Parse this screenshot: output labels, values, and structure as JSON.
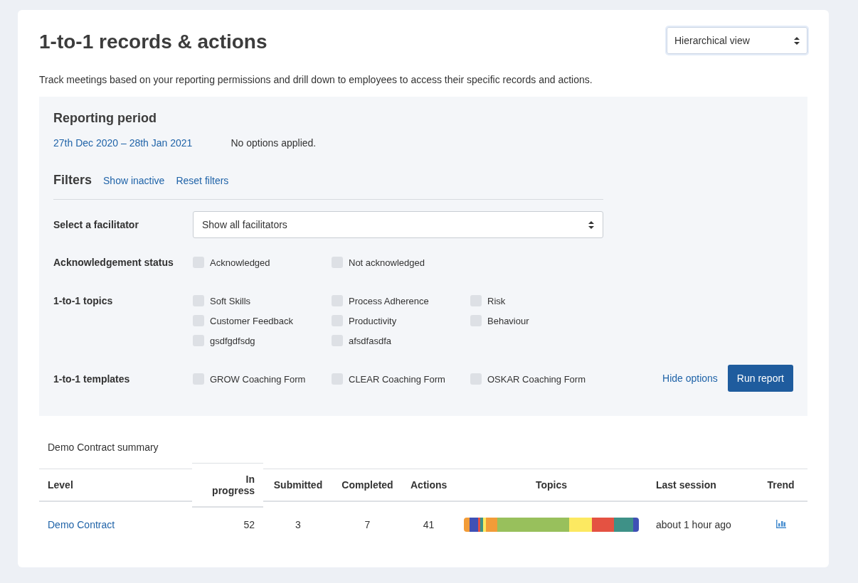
{
  "title": "1-to-1 records & actions",
  "view_select": {
    "value": "Hierarchical view"
  },
  "description": "Track meetings based on your reporting permissions and drill down to employees to access their specific records and actions.",
  "reporting_period": {
    "heading": "Reporting period",
    "date_range": "27th Dec 2020 – 28th Jan 2021",
    "note": "No options applied."
  },
  "filters": {
    "heading": "Filters",
    "links": [
      "Show inactive",
      "Reset filters"
    ],
    "facilitator": {
      "label": "Select a facilitator",
      "value": "Show all facilitators"
    },
    "groups": [
      {
        "label": "Acknowledgement status",
        "options": [
          {
            "label": "Acknowledged",
            "checked": false
          },
          {
            "label": "Not acknowledged",
            "checked": false
          }
        ]
      },
      {
        "label": "1-to-1 topics",
        "options": [
          {
            "label": "Soft Skills",
            "checked": false
          },
          {
            "label": "Process Adherence",
            "checked": false
          },
          {
            "label": "Risk",
            "checked": false
          },
          {
            "label": "Customer Feedback",
            "checked": false
          },
          {
            "label": "Productivity",
            "checked": false
          },
          {
            "label": "Behaviour",
            "checked": false
          },
          {
            "label": "gsdfgdfsdg",
            "checked": false
          },
          {
            "label": "afsdfasdfa",
            "checked": false
          }
        ]
      },
      {
        "label": "1-to-1 templates",
        "options": [
          {
            "label": "GROW Coaching Form",
            "checked": false
          },
          {
            "label": "CLEAR Coaching Form",
            "checked": false
          },
          {
            "label": "OSKAR Coaching Form",
            "checked": false
          }
        ]
      }
    ],
    "hide_options": "Hide options",
    "run_button": "Run report"
  },
  "summary": {
    "title": "Demo Contract summary",
    "columns": [
      "Level",
      "In progress",
      "Submitted",
      "Completed",
      "Actions",
      "Topics",
      "Last session",
      "Trend"
    ],
    "rows": [
      {
        "level": "Demo Contract",
        "in_progress": "52",
        "submitted": "3",
        "completed": "7",
        "actions": "41",
        "last_session": "about 1 hour ago"
      }
    ]
  }
}
